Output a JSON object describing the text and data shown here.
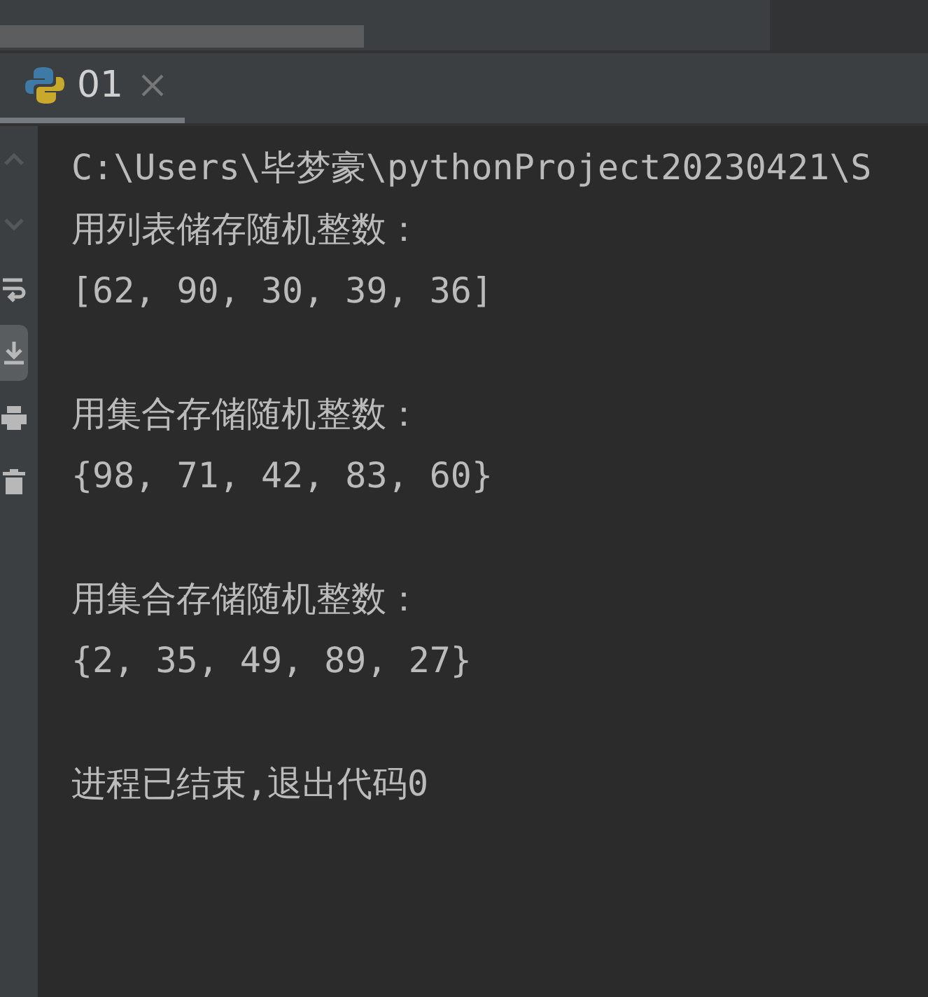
{
  "tabs": [
    {
      "label": "01",
      "selected": true
    }
  ],
  "toolbar": [
    {
      "kind": "up",
      "disabled": true,
      "selected": false
    },
    {
      "kind": "down",
      "disabled": true,
      "selected": false
    },
    {
      "kind": "wrap",
      "disabled": false,
      "selected": false
    },
    {
      "kind": "scroll-end",
      "disabled": false,
      "selected": true
    },
    {
      "kind": "print",
      "disabled": false,
      "selected": false
    },
    {
      "kind": "trash",
      "disabled": false,
      "selected": false
    }
  ],
  "console": {
    "blocks": [
      [
        "C:\\Users\\毕梦豪\\pythonProject20230421\\S",
        "用列表储存随机整数：",
        "[62, 90, 30, 39, 36]"
      ],
      [
        "用集合存储随机整数：",
        "{98, 71, 42, 83, 60}"
      ],
      [
        "用集合存储随机整数：",
        "{2, 35, 49, 89, 27}"
      ],
      [
        "进程已结束,退出代码0"
      ]
    ]
  }
}
